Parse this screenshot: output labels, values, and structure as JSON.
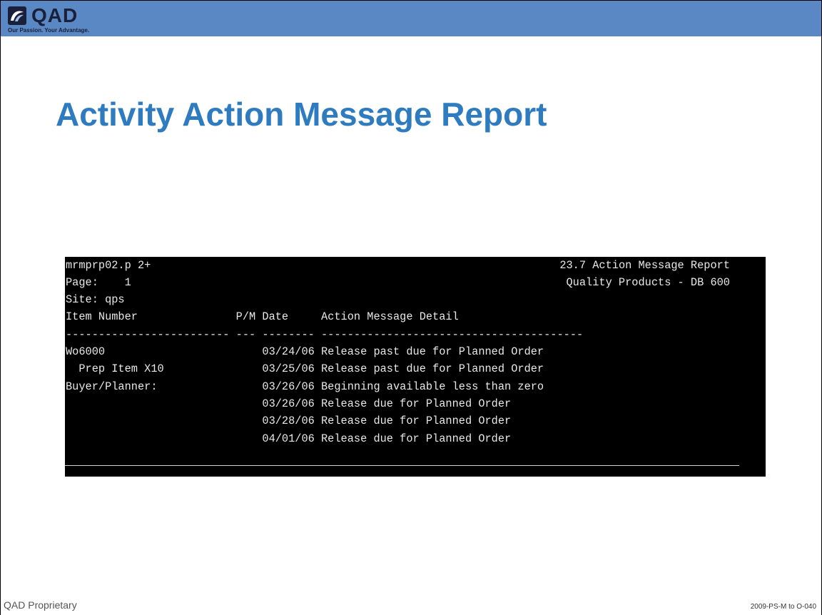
{
  "brand": {
    "logo_text": "QAD",
    "tagline": "Our Passion. Your Advantage.",
    "bar_color": "#5a88c4",
    "logo_icon": "qad-swirl-icon"
  },
  "slide": {
    "title": "Activity Action Message Report",
    "title_color": "#2f7bbf"
  },
  "report": {
    "program": "mrmprp02.p 2+",
    "report_title": "23.7 Action Message Report",
    "page_label": "Page:    1",
    "company": "Quality Products - DB 600",
    "site": "Site: qps",
    "column_header": "Item Number               P/M Date     Action Message Detail",
    "column_rule": "------------------------- --- -------- ----------------------------------------",
    "rows": [
      "Wo6000                        03/24/06 Release past due for Planned Order",
      "  Prep Item X10               03/25/06 Release past due for Planned Order",
      "Buyer/Planner:                03/26/06 Beginning available less than zero",
      "                              03/26/06 Release due for Planned Order",
      "                              03/28/06 Release due for Planned Order",
      "                              04/01/06 Release due for Planned Order"
    ]
  },
  "footer": {
    "left": "QAD Proprietary",
    "right": "2009-PS-M to O-040"
  }
}
